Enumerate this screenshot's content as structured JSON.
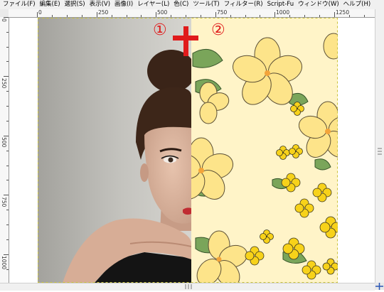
{
  "menu": {
    "items": [
      {
        "label": "ファイル(F)"
      },
      {
        "label": "編集(E)"
      },
      {
        "label": "選択(S)"
      },
      {
        "label": "表示(V)"
      },
      {
        "label": "画像(I)"
      },
      {
        "label": "レイヤー(L)"
      },
      {
        "label": "色(C)"
      },
      {
        "label": "ツール(T)"
      },
      {
        "label": "フィルター(R)"
      },
      {
        "label": "Script-Fu"
      },
      {
        "label": "ウィンドウ(W)"
      },
      {
        "label": "ヘルプ(H)"
      }
    ]
  },
  "ruler": {
    "h_ticks": [
      "0",
      "250",
      "500",
      "750",
      "1000",
      "1250"
    ],
    "v_ticks": [
      "0",
      "250",
      "500",
      "750",
      "1000"
    ]
  },
  "annotations": {
    "left_number": "①",
    "right_number": "②",
    "plus_sign": "+"
  },
  "colors": {
    "annotation_red": "#e01b1b",
    "flower_bg": "#fff4c8",
    "flower_light": "#fde48a",
    "flower_yellow": "#f7d21a",
    "leaf_green": "#7aa55a"
  },
  "icons": {
    "navigate": "navigate-cross-icon"
  }
}
